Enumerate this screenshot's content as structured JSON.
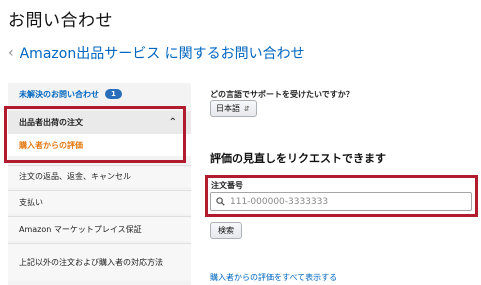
{
  "page": {
    "title": "お問い合わせ"
  },
  "breadcrumb": {
    "label": "Amazon出品サービス に関するお問い合わせ"
  },
  "sidebar": {
    "unresolved": {
      "label": "未解決のお問い合わせ",
      "badge": "1"
    },
    "group": {
      "label": "出品者出荷の注文"
    },
    "selected": {
      "label": "購入者からの評価"
    },
    "items": [
      {
        "label": "注文の返品、返金、キャンセル"
      },
      {
        "label": "支払い"
      },
      {
        "label": "Amazon マーケットプレイス保証"
      },
      {
        "label": "上記以外の注文および購入者の対応方法"
      }
    ]
  },
  "language": {
    "question": "どの言語でサポートを受けたいですか？",
    "selected": "日本語"
  },
  "review_request": {
    "heading": "評価の見直しをリクエストできます",
    "order_label": "注文番号",
    "order_placeholder": "111-000000-3333333",
    "search_button": "検索",
    "view_all_link": "購入者からの評価をすべて表示する"
  },
  "colors": {
    "link": "#0066c0",
    "highlight": "#b11b2e",
    "selected": "#e47911",
    "badge": "#2a6ebb"
  }
}
